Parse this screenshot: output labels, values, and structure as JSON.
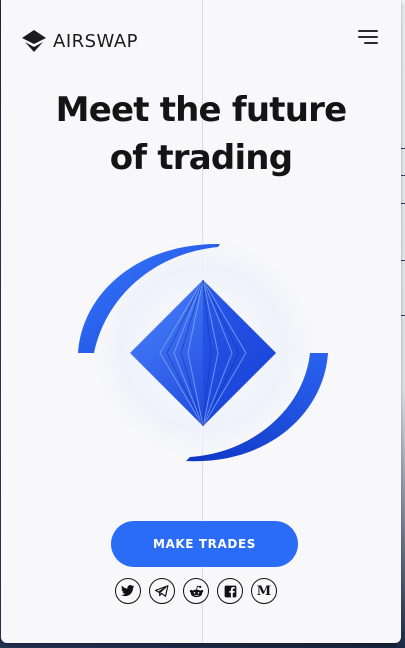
{
  "brand": {
    "name": "AIRSWAP",
    "logo_icon": "airswap-logo-icon"
  },
  "header": {
    "menu_icon": "hamburger-menu-icon"
  },
  "hero": {
    "headline_line1": "Meet the future",
    "headline_line2": "of trading",
    "illustration": "blue-diamond-swap-illustration",
    "accent_color": "#2b6cf6"
  },
  "cta": {
    "label": "MAKE TRADES"
  },
  "socials": [
    {
      "name": "twitter",
      "icon": "twitter-icon"
    },
    {
      "name": "telegram",
      "icon": "telegram-icon"
    },
    {
      "name": "reddit",
      "icon": "reddit-icon"
    },
    {
      "name": "facebook",
      "icon": "facebook-icon"
    },
    {
      "name": "medium",
      "icon": "medium-icon",
      "glyph": "M"
    }
  ]
}
